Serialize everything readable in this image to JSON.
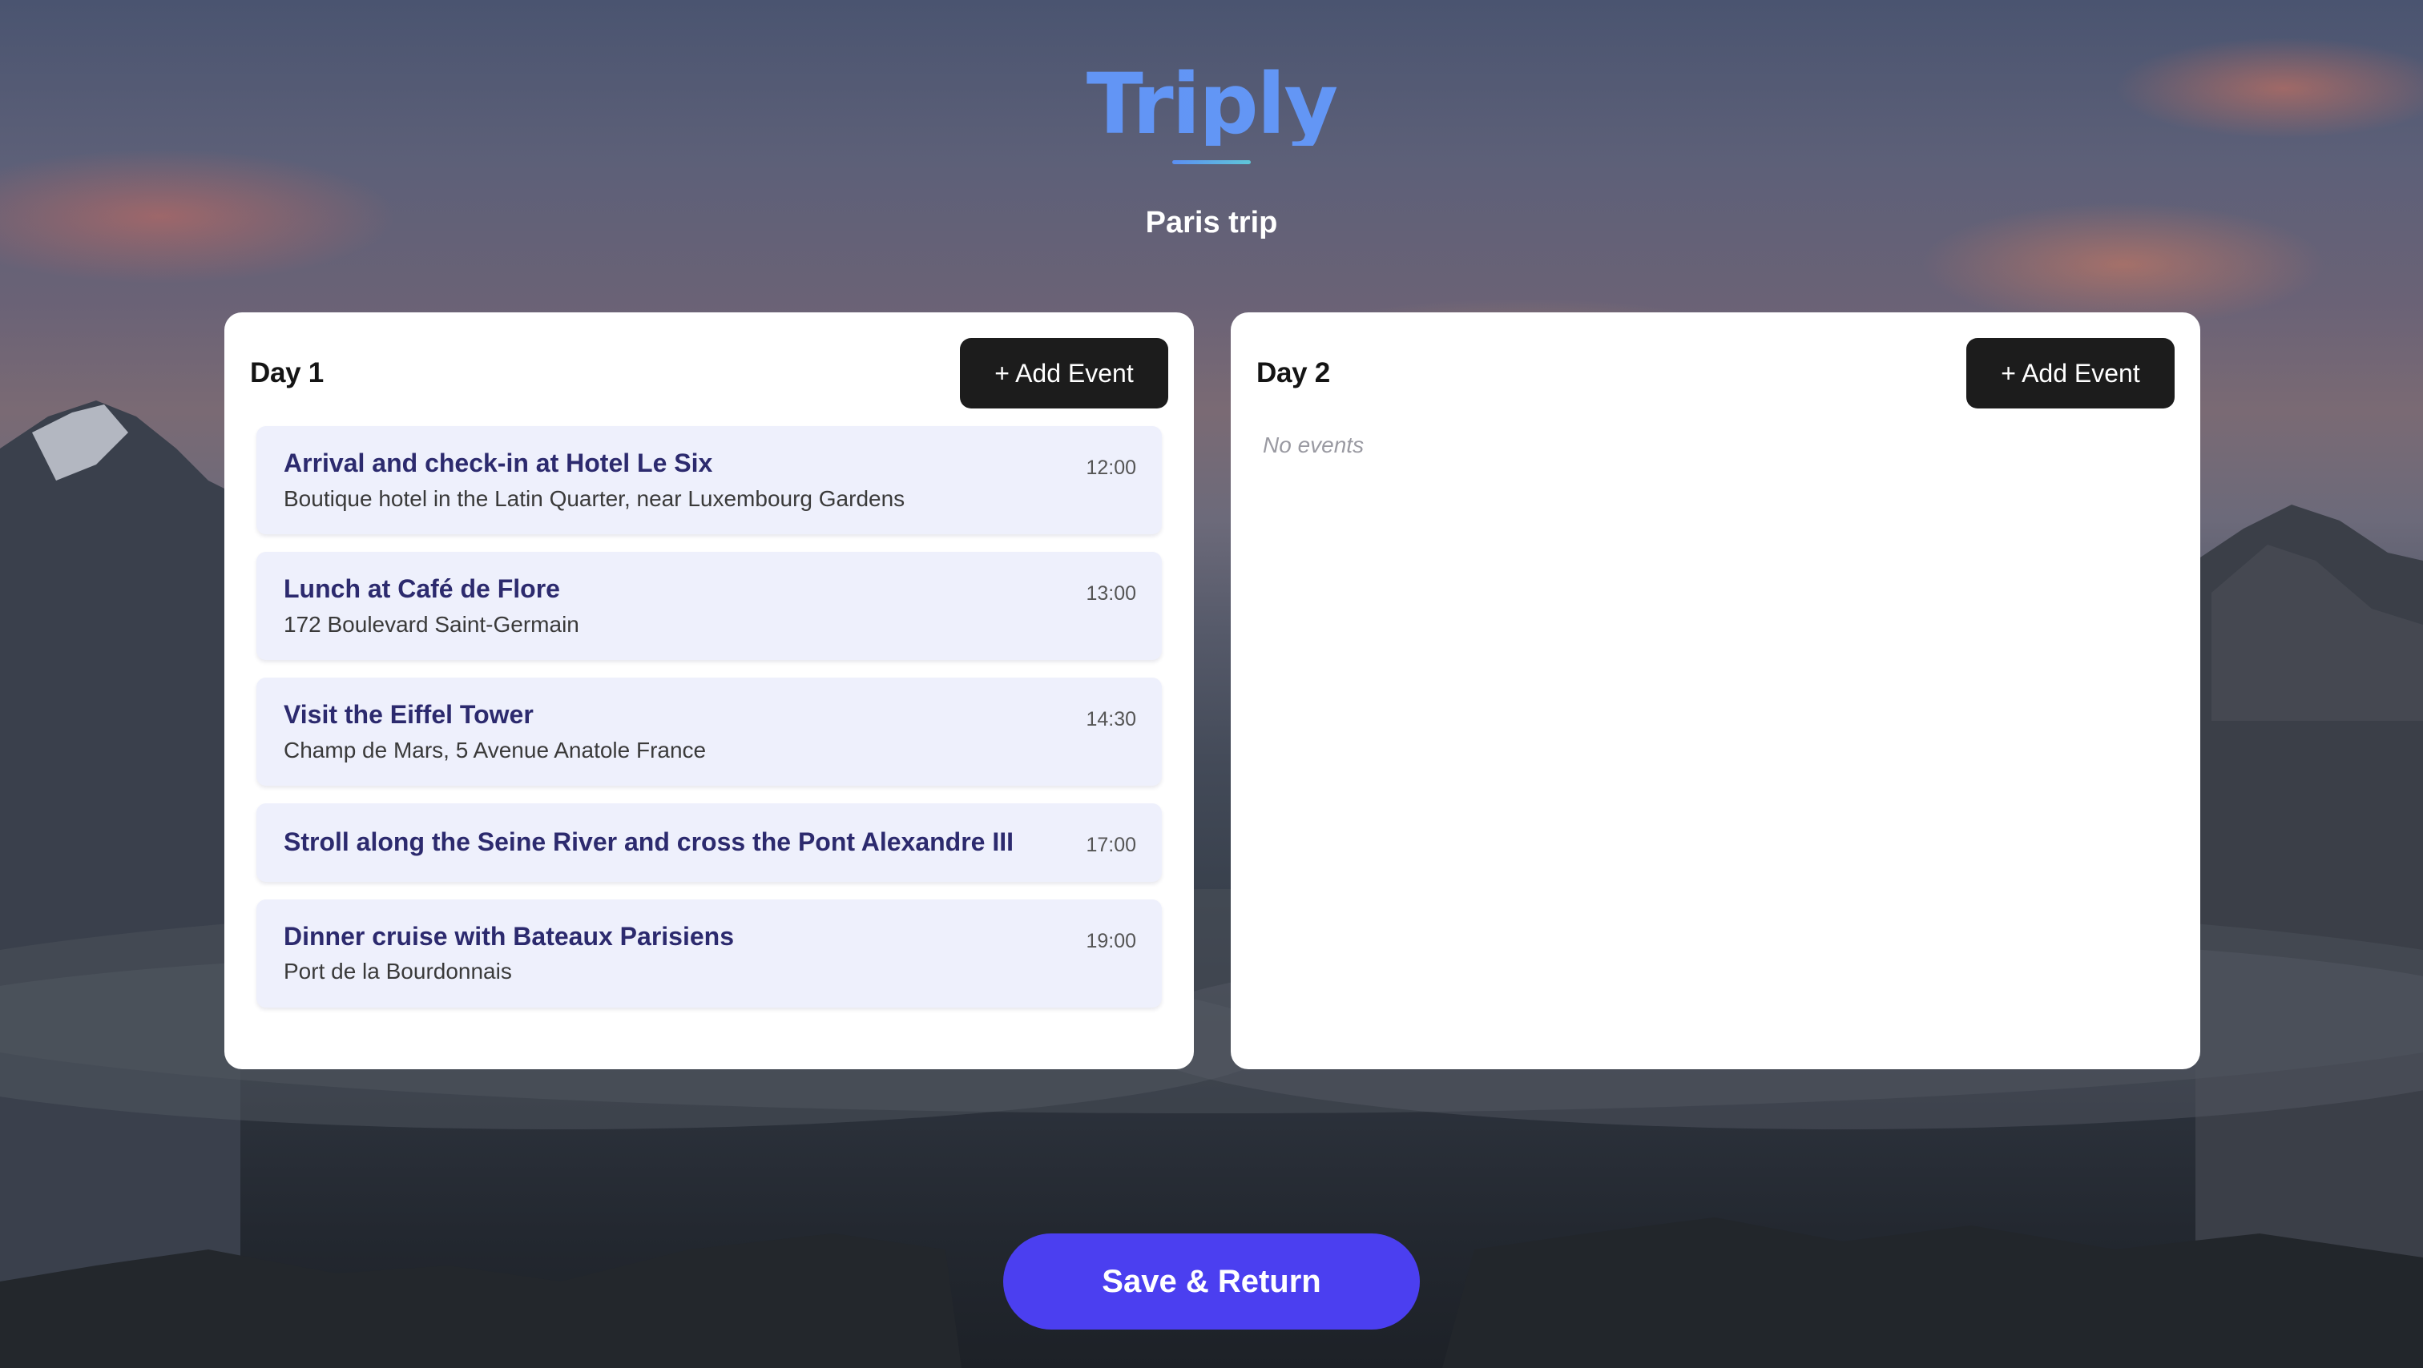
{
  "app": {
    "logo_text": "Triply",
    "trip_name": "Paris trip"
  },
  "days": [
    {
      "title": "Day 1",
      "add_label": "+ Add Event",
      "events": [
        {
          "title": "Arrival and check-in at Hotel Le Six",
          "location": "Boutique hotel in the Latin Quarter, near Luxembourg Gardens",
          "time": "12:00"
        },
        {
          "title": "Lunch at Café de Flore",
          "location": "172 Boulevard Saint-Germain",
          "time": "13:00"
        },
        {
          "title": "Visit the Eiffel Tower",
          "location": "Champ de Mars, 5 Avenue Anatole France",
          "time": "14:30"
        },
        {
          "title": "Stroll along the Seine River and cross the Pont Alexandre III",
          "location": "",
          "time": "17:00"
        },
        {
          "title": "Dinner cruise with Bateaux Parisiens",
          "location": "Port de la Bourdonnais",
          "time": "19:00"
        }
      ]
    },
    {
      "title": "Day 2",
      "add_label": "+ Add Event",
      "empty_text": "No events",
      "events": []
    }
  ],
  "footer": {
    "save_label": "Save & Return"
  },
  "colors": {
    "brand_blue": "#5b8ff3",
    "event_bg": "#eef0fc",
    "event_title": "#2c2a6e",
    "save_button": "#4b3ff0",
    "add_button": "#1c1c1c"
  }
}
